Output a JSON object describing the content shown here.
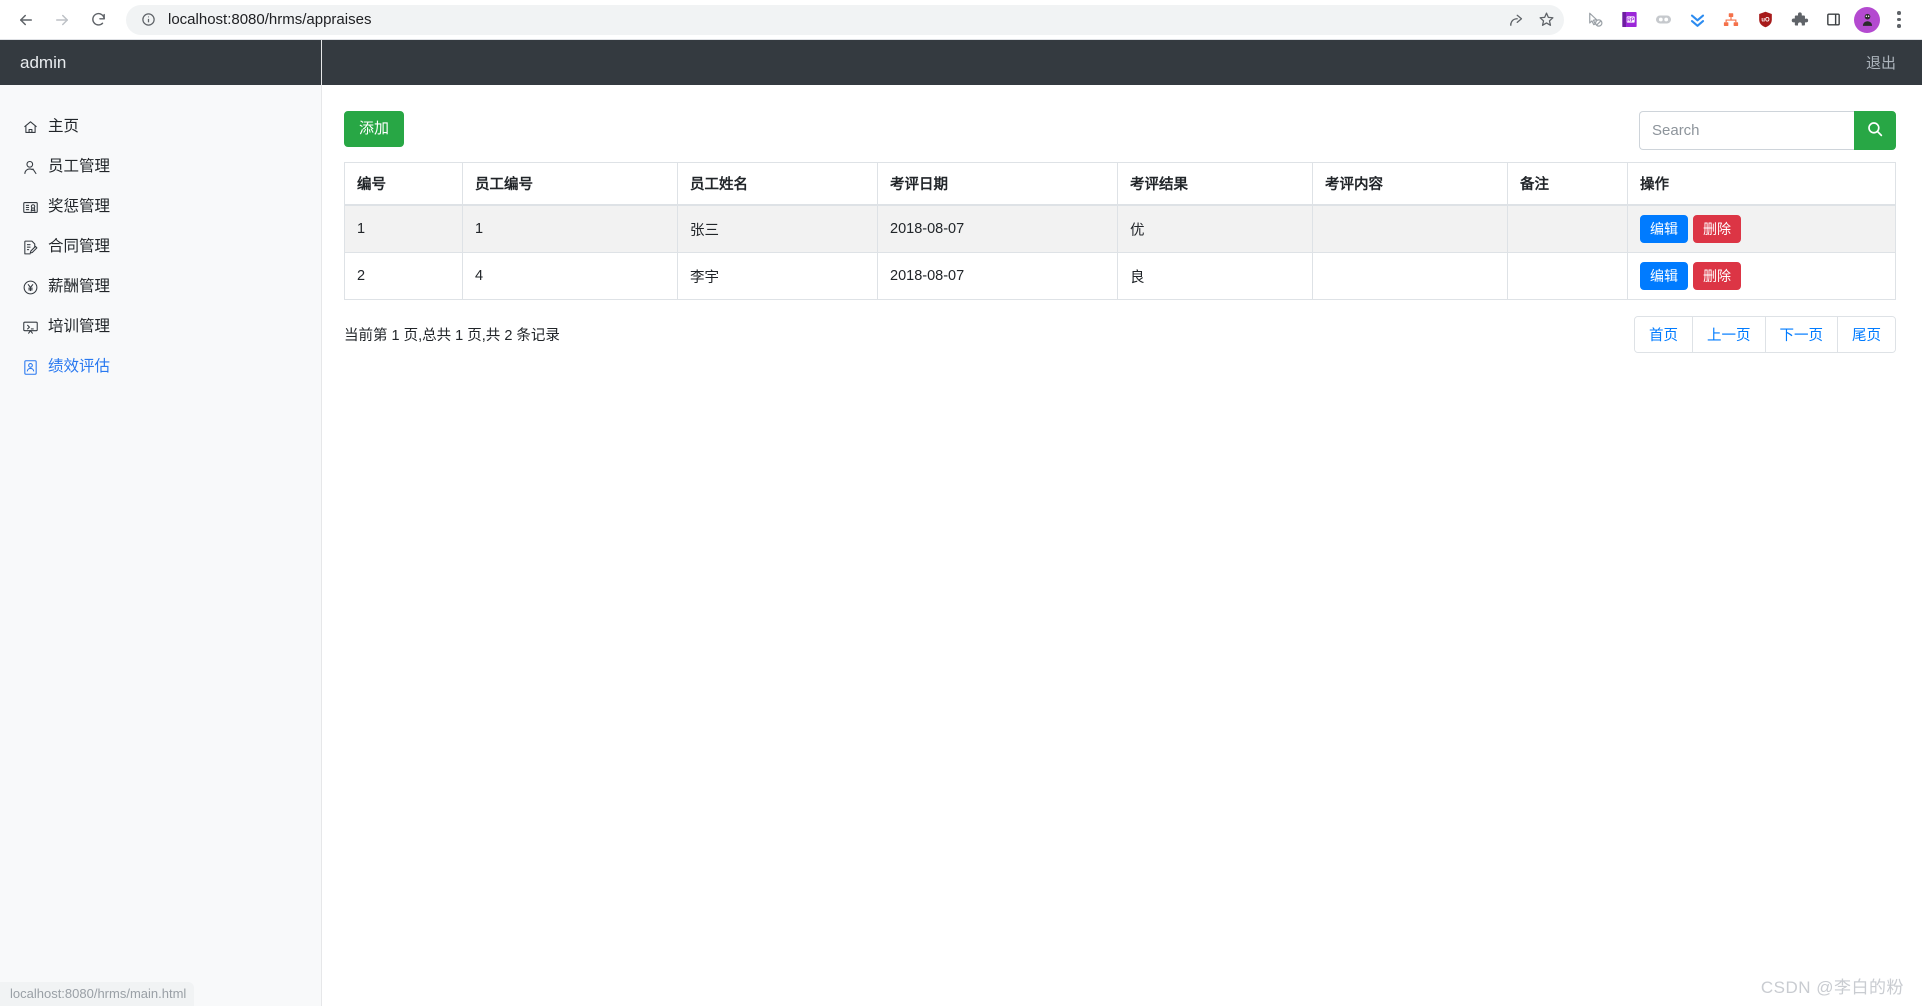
{
  "browser": {
    "url": "localhost:8080/hrms/appraises",
    "back_icon": "back-arrow-icon",
    "forward_icon": "forward-arrow-icon",
    "reload_icon": "reload-icon",
    "info_icon": "site-info-icon",
    "share_icon": "share-icon",
    "bookmark_icon": "star-icon",
    "extensions": [
      {
        "name": "cursor-blocked-icon",
        "label": ""
      },
      {
        "name": "rp-extension-icon",
        "label": "RP"
      },
      {
        "name": "pill-extension-icon",
        "label": ""
      },
      {
        "name": "double-chevron-down-icon",
        "label": ""
      },
      {
        "name": "org-tree-icon",
        "label": ""
      },
      {
        "name": "ublock-shield-icon",
        "label": "uO"
      },
      {
        "name": "puzzle-extensions-icon",
        "label": ""
      },
      {
        "name": "side-panel-icon",
        "label": ""
      }
    ],
    "profile_avatar": "profile-avatar-icon",
    "menu_icon": "three-dot-menu-icon"
  },
  "sidebar": {
    "title": "admin",
    "items": [
      {
        "label": "主页",
        "icon": "home-icon",
        "active": false
      },
      {
        "label": "员工管理",
        "icon": "user-icon",
        "active": false
      },
      {
        "label": "奖惩管理",
        "icon": "award-icon",
        "active": false
      },
      {
        "label": "合同管理",
        "icon": "contract-icon",
        "active": false
      },
      {
        "label": "薪酬管理",
        "icon": "salary-coin-icon",
        "active": false
      },
      {
        "label": "培训管理",
        "icon": "training-icon",
        "active": false
      },
      {
        "label": "绩效评估",
        "icon": "appraisal-icon",
        "active": true
      }
    ]
  },
  "topbar": {
    "logout_label": "退出"
  },
  "toolbar": {
    "add_label": "添加",
    "search_placeholder": "Search",
    "search_value": "",
    "search_icon": "search-icon"
  },
  "table": {
    "columns": [
      "编号",
      "员工编号",
      "员工姓名",
      "考评日期",
      "考评结果",
      "考评内容",
      "备注",
      "操作"
    ],
    "rows": [
      {
        "id": "1",
        "employee_no": "1",
        "employee_name": "张三",
        "appraise_date": "2018-08-07",
        "appraise_result": "优",
        "appraise_content": "",
        "remark": "",
        "edit_label": "编辑",
        "delete_label": "删除"
      },
      {
        "id": "2",
        "employee_no": "4",
        "employee_name": "李宇",
        "appraise_date": "2018-08-07",
        "appraise_result": "良",
        "appraise_content": "",
        "remark": "",
        "edit_label": "编辑",
        "delete_label": "删除"
      }
    ]
  },
  "pager": {
    "summary": "当前第 1 页,总共 1 页,共 2 条记录",
    "links": [
      "首页",
      "上一页",
      "下一页",
      "尾页"
    ]
  },
  "status_bubble": "localhost:8080/hrms/main.html",
  "watermark": "CSDN @李白的粉",
  "colors": {
    "header_dark": "#343a40",
    "sidebar_bg": "#f8f9fa",
    "accent_green": "#28a745",
    "accent_blue": "#007bff",
    "accent_red": "#dc3545",
    "active_link": "#2878f0",
    "row_stripe": "#f2f2f2"
  }
}
